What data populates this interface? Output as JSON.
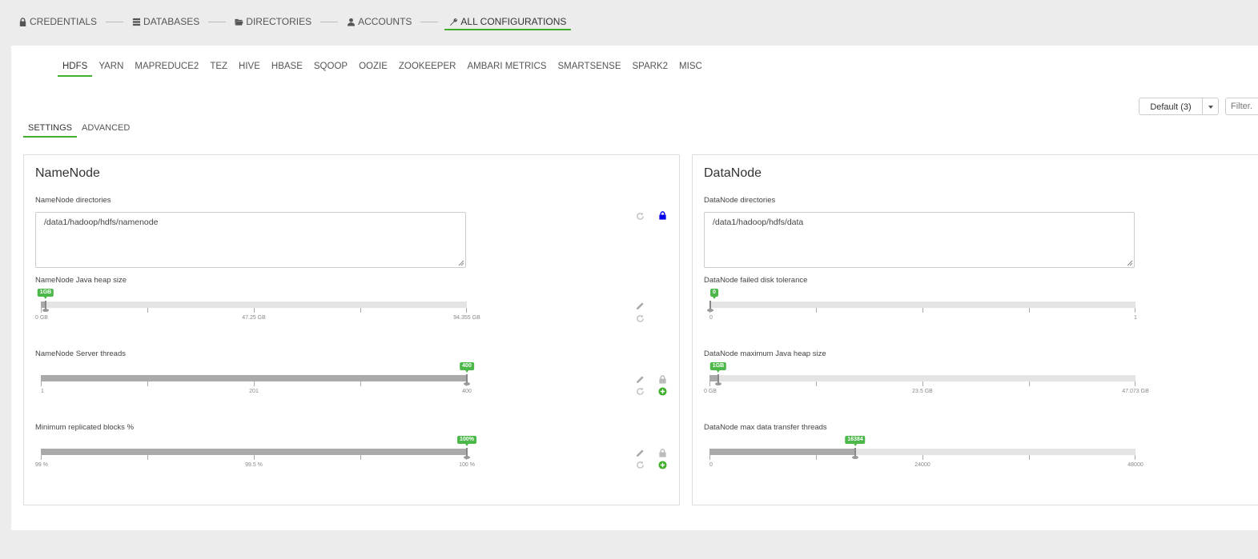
{
  "steps": {
    "credentials": "CREDENTIALS",
    "databases": "DATABASES",
    "directories": "DIRECTORIES",
    "accounts": "ACCOUNTS",
    "all_configurations": "ALL CONFIGURATIONS"
  },
  "services": [
    "HDFS",
    "YARN",
    "MAPREDUCE2",
    "TEZ",
    "HIVE",
    "HBASE",
    "SQOOP",
    "OOZIE",
    "ZOOKEEPER",
    "AMBARI METRICS",
    "SMARTSENSE",
    "SPARK2",
    "MISC"
  ],
  "config_group": {
    "selected": "Default (3)"
  },
  "filter": {
    "placeholder": "Filter..."
  },
  "sub_tabs": {
    "settings": "SETTINGS",
    "advanced": "ADVANCED"
  },
  "namenode": {
    "title": "NameNode",
    "dirs_label": "NameNode directories",
    "dirs_value": "/data1/hadoop/hdfs/namenode",
    "heap": {
      "label": "NameNode Java heap size",
      "value_label": "1GB",
      "fraction": 0.0106,
      "ticks": [
        "0 GB",
        "47.25 GB",
        "94.355 GB"
      ]
    },
    "threads": {
      "label": "NameNode Server threads",
      "value_label": "400",
      "fraction": 1.0,
      "ticks": [
        "1",
        "201",
        "400"
      ]
    },
    "min_blocks": {
      "label": "Minimum replicated blocks %",
      "value_label": "100%",
      "fraction": 1.0,
      "ticks": [
        "99 %",
        "99.5 %",
        "100 %"
      ]
    }
  },
  "datanode": {
    "title": "DataNode",
    "dirs_label": "DataNode directories",
    "dirs_value": "/data1/hadoop/hdfs/data",
    "failed_disk": {
      "label": "DataNode failed disk tolerance",
      "value_label": "0",
      "fraction": 0.0,
      "ticks": [
        "0",
        "1"
      ]
    },
    "heap": {
      "label": "DataNode maximum Java heap size",
      "value_label": "1GB",
      "fraction": 0.0212,
      "ticks": [
        "0 GB",
        "23.5 GB",
        "47.073 GB"
      ]
    },
    "transfer": {
      "label": "DataNode max data transfer threads",
      "value_label": "16384",
      "fraction": 0.3413,
      "ticks": [
        "0",
        "24000",
        "48000"
      ]
    }
  },
  "colors": {
    "accent": "#3fae2a",
    "badge": "#4cb84a",
    "lock_blue": "#0000ee"
  }
}
